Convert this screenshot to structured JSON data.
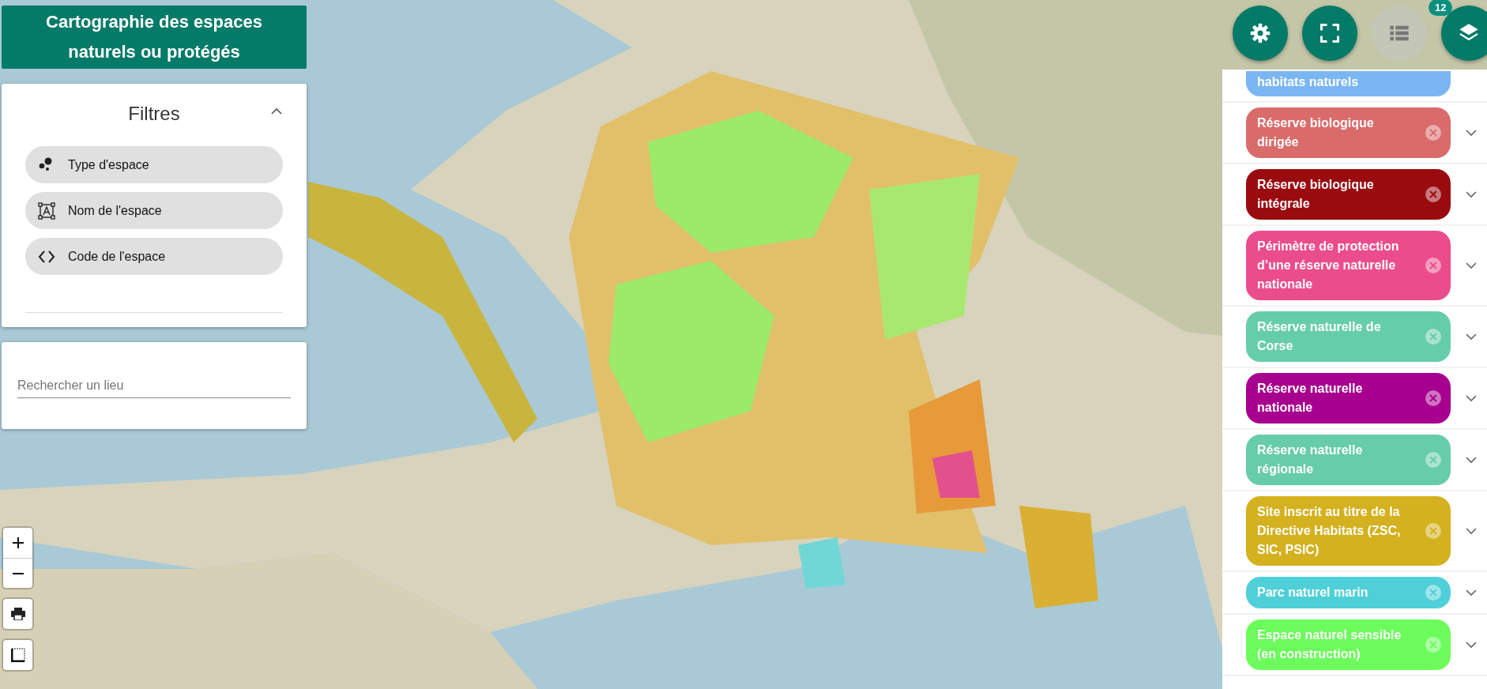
{
  "title": "Cartographie des espaces naturels ou protégés",
  "filters": {
    "title": "Filtres",
    "expanded": true,
    "items": [
      {
        "kind": "type",
        "label": "Type d'espace"
      },
      {
        "kind": "name",
        "label": "Nom de l'espace"
      },
      {
        "kind": "code",
        "label": "Code de l'espace"
      }
    ]
  },
  "search": {
    "placeholder": "Rechercher un lieu"
  },
  "toolbar": [
    {
      "kind": "settings",
      "disabled": false
    },
    {
      "kind": "fullscreen",
      "disabled": false
    },
    {
      "kind": "list",
      "disabled": true
    },
    {
      "kind": "layers",
      "disabled": false,
      "badge": "12"
    }
  ],
  "layers": [
    {
      "label": "habitats naturels",
      "color": "#7ab6f2"
    },
    {
      "label": "Réserve biologique dirigée",
      "color": "#d96c6a"
    },
    {
      "label": "Réserve biologique intégrale",
      "color": "#9a0b10"
    },
    {
      "label": "Périmètre de protection d’une réserve naturelle nationale",
      "color": "#eb4d8c"
    },
    {
      "label": "Réserve naturelle de Corse",
      "color": "#66cdaa"
    },
    {
      "label": "Réserve naturelle nationale",
      "color": "#a7008e"
    },
    {
      "label": "Réserve naturelle régionale",
      "color": "#66cca9"
    },
    {
      "label": "Site inscrit au titre de la Directive Habitats (ZSC, SIC, PSIC)",
      "color": "#d4b11e"
    },
    {
      "label": "Parc naturel marin",
      "color": "#4fd0d8"
    },
    {
      "label": "Espace naturel sensible (en construction)",
      "color": "#6cfd5c"
    }
  ]
}
